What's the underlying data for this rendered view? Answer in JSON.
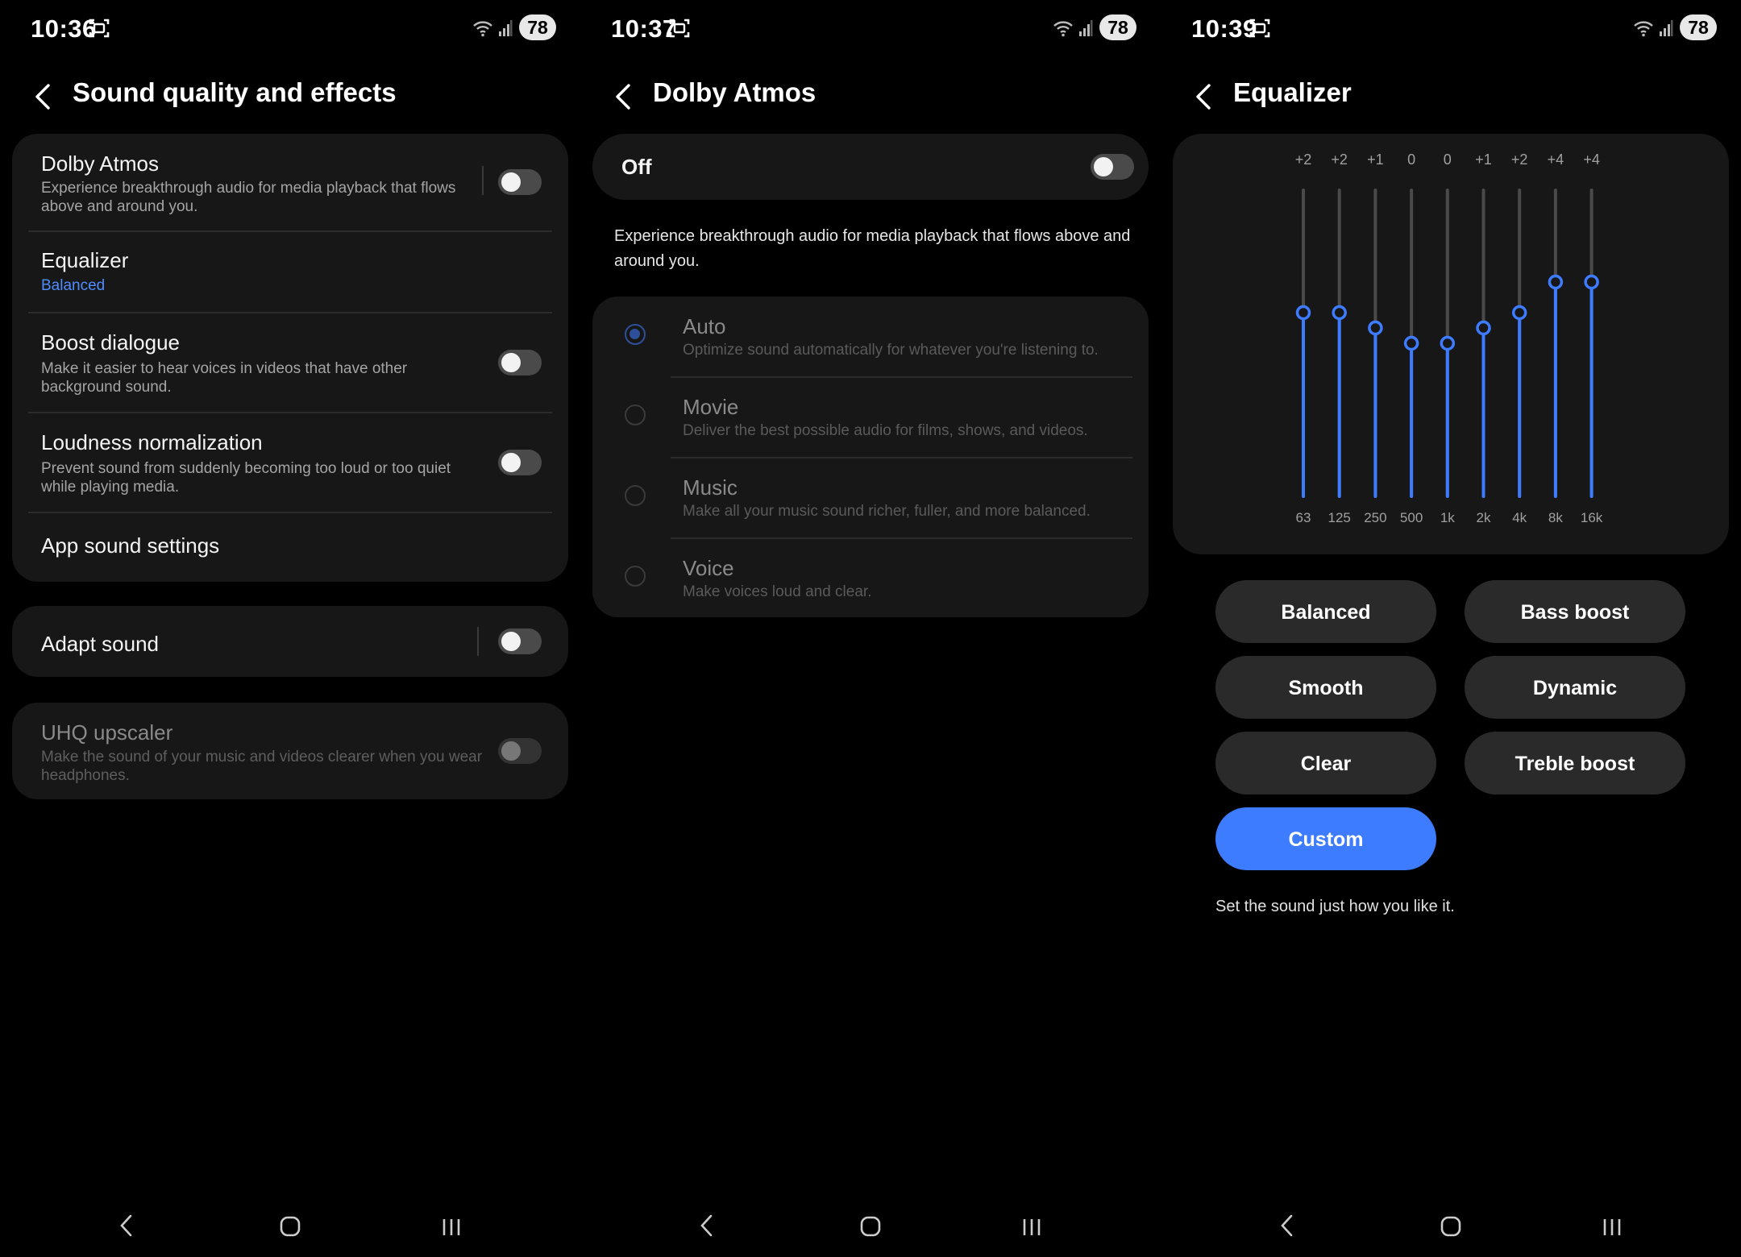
{
  "battery": "78",
  "screen1": {
    "time": "10:36",
    "title": "Sound quality and effects",
    "dolby_title": "Dolby Atmos",
    "dolby_desc": "Experience breakthrough audio for media playback that flows above and around you.",
    "equalizer_title": "Equalizer",
    "equalizer_value": "Balanced",
    "boost_title": "Boost dialogue",
    "boost_desc": "Make it easier to hear voices in videos that have other background sound.",
    "loud_title": "Loudness normalization",
    "loud_desc": "Prevent sound from suddenly becoming too loud or too quiet while playing media.",
    "app_sound": "App sound settings",
    "adapt": "Adapt sound",
    "uhq_title": "UHQ upscaler",
    "uhq_desc": "Make the sound of your music and videos clearer when you wear headphones."
  },
  "screen2": {
    "time": "10:37",
    "title": "Dolby Atmos",
    "master_label": "Off",
    "desc": "Experience breakthrough audio for media playback that flows above and around you.",
    "options": [
      {
        "title": "Auto",
        "desc": "Optimize sound automatically for whatever you're listening to.",
        "selected": true
      },
      {
        "title": "Movie",
        "desc": "Deliver the best possible audio for films, shows, and videos.",
        "selected": false
      },
      {
        "title": "Music",
        "desc": "Make all your music sound richer, fuller, and more balanced.",
        "selected": false
      },
      {
        "title": "Voice",
        "desc": "Make voices loud and clear.",
        "selected": false
      }
    ]
  },
  "screen3": {
    "time": "10:39",
    "title": "Equalizer",
    "presets": [
      "Balanced",
      "Bass boost",
      "Smooth",
      "Dynamic",
      "Clear",
      "Treble boost",
      "Custom"
    ],
    "active_preset": "Custom",
    "preset_desc": "Set the sound just how you like it."
  },
  "chart_data": {
    "type": "bar",
    "categories": [
      "63",
      "125",
      "250",
      "500",
      "1k",
      "2k",
      "4k",
      "8k",
      "16k"
    ],
    "values": [
      2,
      2,
      1,
      0,
      0,
      1,
      2,
      4,
      4
    ],
    "value_labels": [
      "+2",
      "+2",
      "+1",
      "0",
      "0",
      "+1",
      "+2",
      "+4",
      "+4"
    ],
    "ylim": [
      -10,
      10
    ]
  },
  "colors": {
    "accent": "#3d7bff",
    "link": "#4e8cff",
    "card": "#171717",
    "background": "#000000"
  }
}
